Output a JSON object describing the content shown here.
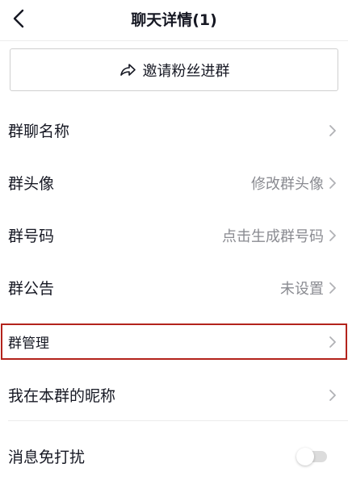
{
  "header": {
    "title": "聊天详情(1)"
  },
  "invite": {
    "label": "邀请粉丝进群"
  },
  "rows": [
    {
      "label": "群聊名称",
      "value": ""
    },
    {
      "label": "群头像",
      "value": "修改群头像"
    },
    {
      "label": "群号码",
      "value": "点击生成群号码"
    },
    {
      "label": "群公告",
      "value": "未设置"
    },
    {
      "label": "群管理",
      "value": ""
    },
    {
      "label": "我在本群的昵称",
      "value": ""
    }
  ],
  "dnd": {
    "label": "消息免打扰",
    "enabled": false
  },
  "colors": {
    "highlight_border": "#b3231c",
    "secondary_text": "#8a8b91",
    "primary_text": "#161823"
  }
}
